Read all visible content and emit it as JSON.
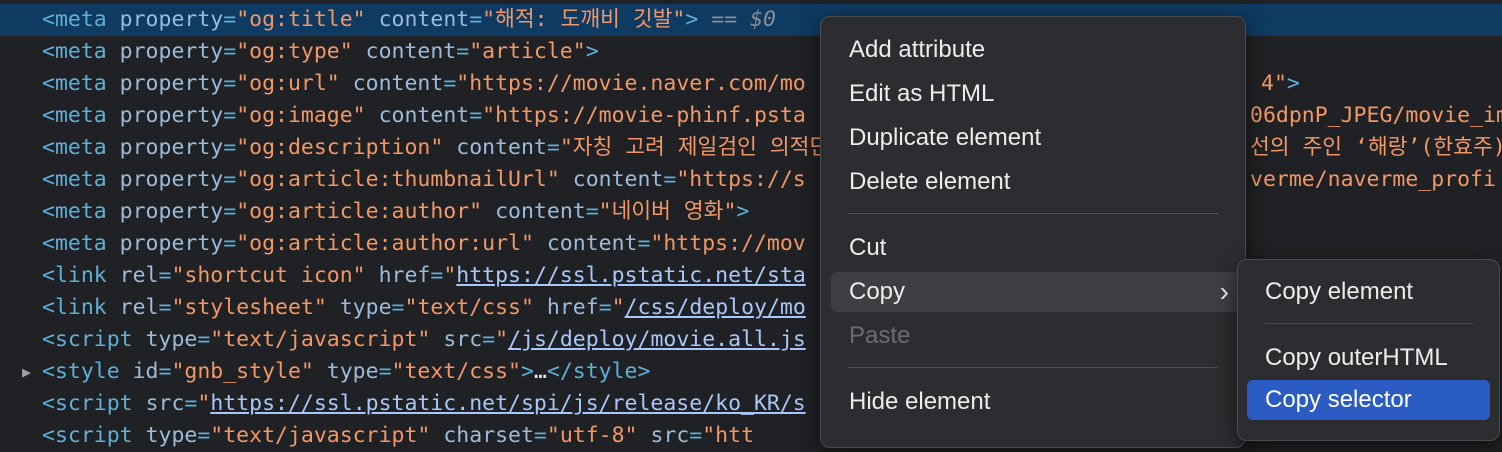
{
  "code": {
    "lines": [
      {
        "segs": [
          [
            "t",
            "<meta "
          ],
          [
            "a",
            "property"
          ],
          [
            "p",
            "="
          ],
          [
            "v",
            "\"og:title\""
          ],
          [
            "p",
            " "
          ],
          [
            "a",
            "content"
          ],
          [
            "p",
            "="
          ],
          [
            "v",
            "\"해적: 도깨비 깃발\""
          ],
          [
            "t",
            ">"
          ],
          [
            "ref",
            " == $0"
          ]
        ]
      },
      {
        "segs": [
          [
            "t",
            "<meta "
          ],
          [
            "a",
            "property"
          ],
          [
            "p",
            "="
          ],
          [
            "v",
            "\"og:type\""
          ],
          [
            "p",
            " "
          ],
          [
            "a",
            "content"
          ],
          [
            "p",
            "="
          ],
          [
            "v",
            "\"article\""
          ],
          [
            "t",
            ">"
          ]
        ]
      },
      {
        "segs": [
          [
            "t",
            "<meta "
          ],
          [
            "a",
            "property"
          ],
          [
            "p",
            "="
          ],
          [
            "v",
            "\"og:url\""
          ],
          [
            "p",
            " "
          ],
          [
            "a",
            "content"
          ],
          [
            "p",
            "="
          ],
          [
            "v",
            "\"https://movie.naver.com/mo"
          ]
        ]
      },
      {
        "segs": [
          [
            "t",
            "<meta "
          ],
          [
            "a",
            "property"
          ],
          [
            "p",
            "="
          ],
          [
            "v",
            "\"og:image\""
          ],
          [
            "p",
            " "
          ],
          [
            "a",
            "content"
          ],
          [
            "p",
            "="
          ],
          [
            "v",
            "\"https://movie-phinf.psta"
          ]
        ]
      },
      {
        "segs": [
          [
            "t",
            "<meta "
          ],
          [
            "a",
            "property"
          ],
          [
            "p",
            "="
          ],
          [
            "v",
            "\"og:description\""
          ],
          [
            "p",
            " "
          ],
          [
            "a",
            "content"
          ],
          [
            "p",
            "="
          ],
          [
            "v",
            "\"자칭 고려 제일검인 의적딘"
          ]
        ]
      },
      {
        "segs": [
          [
            "t",
            "<meta "
          ],
          [
            "a",
            "property"
          ],
          [
            "p",
            "="
          ],
          [
            "v",
            "\"og:article:thumbnailUrl\""
          ],
          [
            "p",
            " "
          ],
          [
            "a",
            "content"
          ],
          [
            "p",
            "="
          ],
          [
            "v",
            "\"https://s"
          ]
        ]
      },
      {
        "segs": [
          [
            "t",
            "<meta "
          ],
          [
            "a",
            "property"
          ],
          [
            "p",
            "="
          ],
          [
            "v",
            "\"og:article:author\""
          ],
          [
            "p",
            " "
          ],
          [
            "a",
            "content"
          ],
          [
            "p",
            "="
          ],
          [
            "v",
            "\"네이버 영화\""
          ],
          [
            "t",
            ">"
          ]
        ]
      },
      {
        "segs": [
          [
            "t",
            "<meta "
          ],
          [
            "a",
            "property"
          ],
          [
            "p",
            "="
          ],
          [
            "v",
            "\"og:article:author:url\""
          ],
          [
            "p",
            " "
          ],
          [
            "a",
            "content"
          ],
          [
            "p",
            "="
          ],
          [
            "v",
            "\"https://mov"
          ]
        ]
      },
      {
        "segs": [
          [
            "t",
            "<link "
          ],
          [
            "a",
            "rel"
          ],
          [
            "p",
            "="
          ],
          [
            "v",
            "\"shortcut icon\""
          ],
          [
            "p",
            " "
          ],
          [
            "a",
            "href"
          ],
          [
            "p",
            "="
          ],
          [
            "v",
            "\""
          ],
          [
            "lk",
            "https://ssl.pstatic.net/sta"
          ]
        ]
      },
      {
        "segs": [
          [
            "t",
            "<link "
          ],
          [
            "a",
            "rel"
          ],
          [
            "p",
            "="
          ],
          [
            "v",
            "\"stylesheet\""
          ],
          [
            "p",
            " "
          ],
          [
            "a",
            "type"
          ],
          [
            "p",
            "="
          ],
          [
            "v",
            "\"text/css\""
          ],
          [
            "p",
            " "
          ],
          [
            "a",
            "href"
          ],
          [
            "p",
            "="
          ],
          [
            "v",
            "\""
          ],
          [
            "lk",
            "/css/deploy/mo"
          ]
        ]
      },
      {
        "segs": [
          [
            "t",
            "<script "
          ],
          [
            "a",
            "type"
          ],
          [
            "p",
            "="
          ],
          [
            "v",
            "\"text/javascript\""
          ],
          [
            "p",
            " "
          ],
          [
            "a",
            "src"
          ],
          [
            "p",
            "="
          ],
          [
            "v",
            "\""
          ],
          [
            "lk",
            "/js/deploy/movie.all.js"
          ]
        ]
      },
      {
        "segs": [
          [
            "t",
            "<style "
          ],
          [
            "a",
            "id"
          ],
          [
            "p",
            "="
          ],
          [
            "v",
            "\"gnb_style\""
          ],
          [
            "p",
            " "
          ],
          [
            "a",
            "type"
          ],
          [
            "p",
            "="
          ],
          [
            "v",
            "\"text/css\""
          ],
          [
            "t",
            ">"
          ],
          [
            "d",
            "…"
          ],
          [
            "t",
            "</style>"
          ]
        ]
      },
      {
        "segs": [
          [
            "t",
            "<script "
          ],
          [
            "a",
            "src"
          ],
          [
            "p",
            "="
          ],
          [
            "v",
            "\""
          ],
          [
            "lk",
            "https://ssl.pstatic.net/spi/js/release/ko_KR/s"
          ]
        ]
      },
      {
        "segs": [
          [
            "t",
            "<script "
          ],
          [
            "a",
            "type"
          ],
          [
            "p",
            "="
          ],
          [
            "v",
            "\"text/javascript\""
          ],
          [
            "p",
            " "
          ],
          [
            "a",
            "charset"
          ],
          [
            "p",
            "="
          ],
          [
            "v",
            "\"utf-8\""
          ],
          [
            "p",
            " "
          ],
          [
            "a",
            "src"
          ],
          [
            "p",
            "="
          ],
          [
            "v",
            "\"htt"
          ]
        ]
      }
    ],
    "right_fragments": [
      {
        "row": 2,
        "segs": [
          [
            "v",
            "4\""
          ],
          [
            "t",
            ">"
          ]
        ]
      },
      {
        "row": 3,
        "segs": [
          [
            "v",
            "06dpnP_JPEG/movie_im"
          ]
        ]
      },
      {
        "row": 4,
        "segs": [
          [
            "v",
            "선의 주인 ‘해랑’(한효주)."
          ]
        ]
      },
      {
        "row": 5,
        "segs": [
          [
            "v",
            "verme/naverme_profi"
          ]
        ]
      }
    ]
  },
  "context_menu": {
    "add_attribute": "Add attribute",
    "edit_as_html": "Edit as HTML",
    "duplicate_element": "Duplicate element",
    "delete_element": "Delete element",
    "cut": "Cut",
    "copy": "Copy",
    "paste": "Paste",
    "hide_element": "Hide element"
  },
  "copy_submenu": {
    "copy_element": "Copy element",
    "copy_outerhtml": "Copy outerHTML",
    "copy_selector": "Copy selector"
  },
  "colors": {
    "background": "#202124",
    "selected_row": "#0f3a61",
    "tag": "#5db0d7",
    "attribute": "#9bbbdc",
    "value": "#f29766",
    "menu_bg": "#2c2d30",
    "menu_highlight": "#3e3f43",
    "submenu_active": "#2b5cc4"
  },
  "icons": {
    "expand_triangle": "caret-right-icon",
    "submenu_chevron": "chevron-right-icon"
  }
}
